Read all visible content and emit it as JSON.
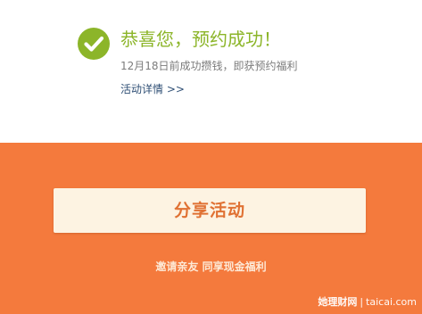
{
  "success": {
    "icon": "checkmark-icon",
    "title": "恭喜您，预约成功！",
    "description": "12月18日前成功攒钱，即获预约福利",
    "detail_link": "活动详情 >>"
  },
  "share": {
    "button_label": "分享活动",
    "invite_text": "邀请亲友 同享现金福利"
  },
  "watermark": {
    "brand": "她理财网",
    "separator": "|",
    "domain": "taicai.com"
  },
  "colors": {
    "success_green": "#8cb529",
    "orange_background": "#f47a3d",
    "button_background": "#fdf3e2",
    "button_text": "#e07133",
    "link_blue": "#2f4f75"
  }
}
